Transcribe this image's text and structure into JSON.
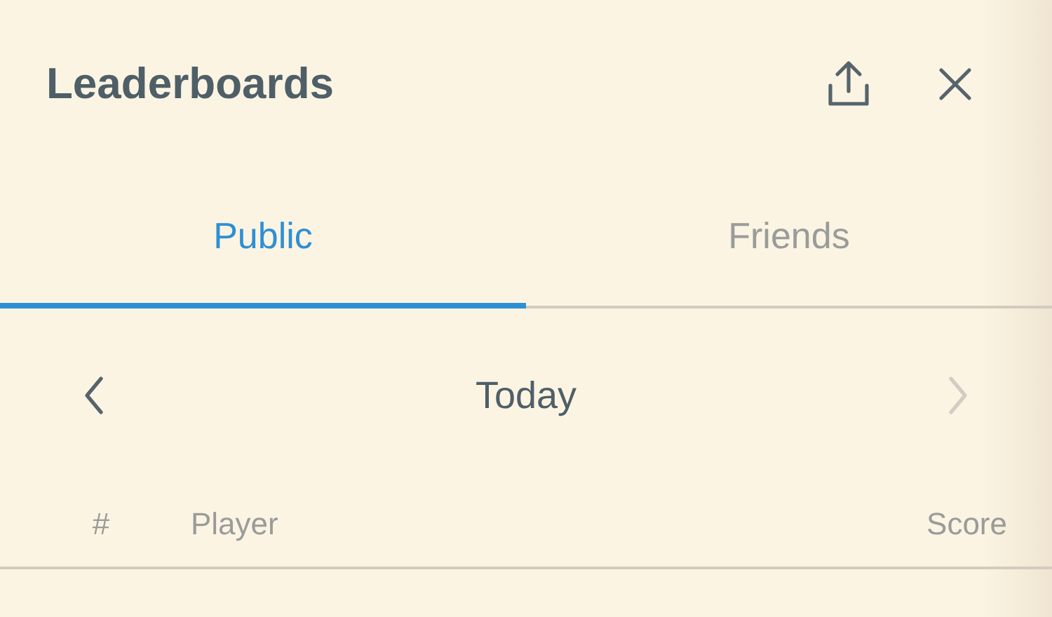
{
  "window": {
    "title": "Leaderboards"
  },
  "toolbar": [
    {
      "kind": "share"
    },
    {
      "kind": "close"
    }
  ],
  "tabs": [
    {
      "label": "Public",
      "selected": true
    },
    {
      "label": "Friends",
      "selected": false
    }
  ],
  "period": {
    "label": "Today",
    "previous": {
      "disabled": false
    },
    "next": {
      "disabled": true
    }
  },
  "table": {
    "columns": [
      {
        "label": "#"
      },
      {
        "label": "Player"
      },
      {
        "label": "Score"
      }
    ]
  }
}
